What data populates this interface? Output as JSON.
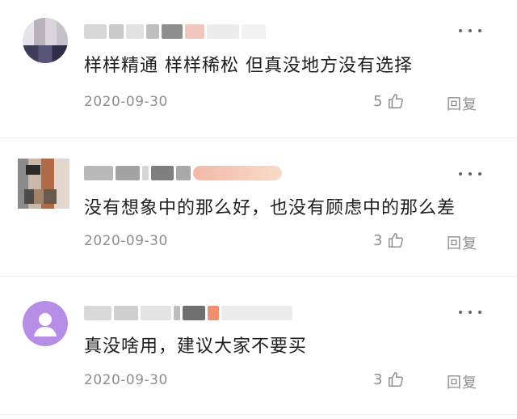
{
  "comments": [
    {
      "text": "样样精通 样样稀松 但真没地方没有选择",
      "date": "2020-09-30",
      "likes": "5",
      "reply_label": "回复",
      "avatar": "pixelated-photo"
    },
    {
      "text": "没有想象中的那么好，也没有顾虑中的那么差",
      "date": "2020-09-30",
      "likes": "3",
      "reply_label": "回复",
      "avatar": "pixelated-photo"
    },
    {
      "text": "真没啥用，建议大家不要买",
      "date": "2020-09-30",
      "likes": "3",
      "reply_label": "回复",
      "avatar": "default-user-avatar"
    }
  ],
  "colors": {
    "text": "#1e1e1e",
    "meta": "#8e8e8e",
    "default_avatar": "#b78ee6",
    "divider": "#ececec"
  },
  "icons": {
    "more": "more-dots-icon",
    "like": "thumbs-up-icon",
    "avatar_default": "user-silhouette-icon"
  }
}
